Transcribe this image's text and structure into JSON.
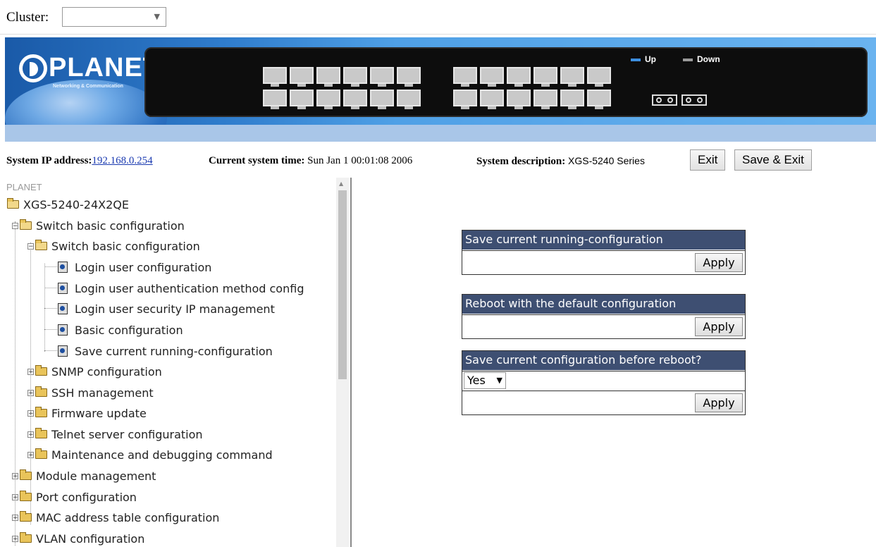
{
  "cluster": {
    "label": "Cluster:",
    "selected": ""
  },
  "banner": {
    "brand": "PLANET",
    "tagline": "Networking & Communication",
    "legend_up": "Up",
    "legend_down": "Down",
    "colors": {
      "up": "#3d8fe0",
      "down": "#9a9a9a"
    }
  },
  "info": {
    "ip_label": "System IP address:",
    "ip_value": "192.168.0.254",
    "time_label": "Current system time:",
    "time_value": "Sun Jan 1 00:01:08 2006",
    "desc_label": "System description:",
    "desc_value": "XGS-5240 Series",
    "exit": "Exit",
    "save_exit": "Save & Exit"
  },
  "tree": {
    "root": "PLANET",
    "device": "XGS-5240-24X2QE",
    "items": [
      "Switch basic configuration",
      "Switch basic configuration",
      "Login user configuration",
      "Login user authentication method config",
      "Login user security IP management",
      "Basic configuration",
      "Save current running-configuration",
      "SNMP configuration",
      "SSH management",
      "Firmware update",
      "Telnet server configuration",
      "Maintenance and debugging command",
      "Module management",
      "Port configuration",
      "MAC address table configuration",
      "VLAN configuration"
    ]
  },
  "main": {
    "box1_title": "Save current running-configuration",
    "box2_title": "Reboot with the default configuration",
    "box3_title": "Save current configuration before reboot?",
    "box3_select": "Yes",
    "apply": "Apply"
  }
}
